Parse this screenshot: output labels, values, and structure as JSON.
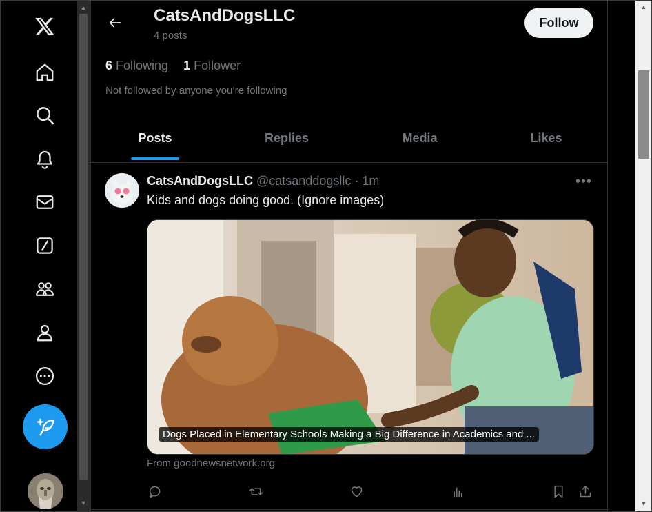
{
  "nav": {
    "items": [
      {
        "name": "x-logo-icon"
      },
      {
        "name": "home-icon"
      },
      {
        "name": "search-icon"
      },
      {
        "name": "notifications-icon"
      },
      {
        "name": "messages-icon"
      },
      {
        "name": "grok-icon"
      },
      {
        "name": "communities-icon"
      },
      {
        "name": "profile-icon"
      },
      {
        "name": "more-icon"
      }
    ],
    "compose_icon": "feather-plus-icon",
    "accent_color": "#1d9bf0"
  },
  "header": {
    "display_name": "CatsAndDogsLLC",
    "post_count": "4 posts",
    "follow_label": "Follow"
  },
  "profile": {
    "following_count": "6",
    "following_label": "Following",
    "followers_count": "1",
    "followers_label": "Follower",
    "not_followed_text": "Not followed by anyone you’re following"
  },
  "tabs": {
    "items": [
      "Posts",
      "Replies",
      "Media",
      "Likes"
    ],
    "active": "Posts"
  },
  "post": {
    "display_name": "CatsAndDogsLLC",
    "handle": "@catsanddogsllc",
    "time": "· 1m",
    "text": "Kids and dogs doing good. (Ignore images)",
    "card_caption": "Dogs Placed in Elementary Schools Making a Big Difference in Academics and ...",
    "link_source": "From goodnewsnetwork.org",
    "actions": [
      "reply-icon",
      "repost-icon",
      "like-icon",
      "views-icon",
      "bookmark-icon",
      "share-icon"
    ]
  },
  "colors": {
    "background": "#000000",
    "text_primary": "#e7e9ea",
    "text_secondary": "#71767b",
    "border": "#2f3336"
  }
}
